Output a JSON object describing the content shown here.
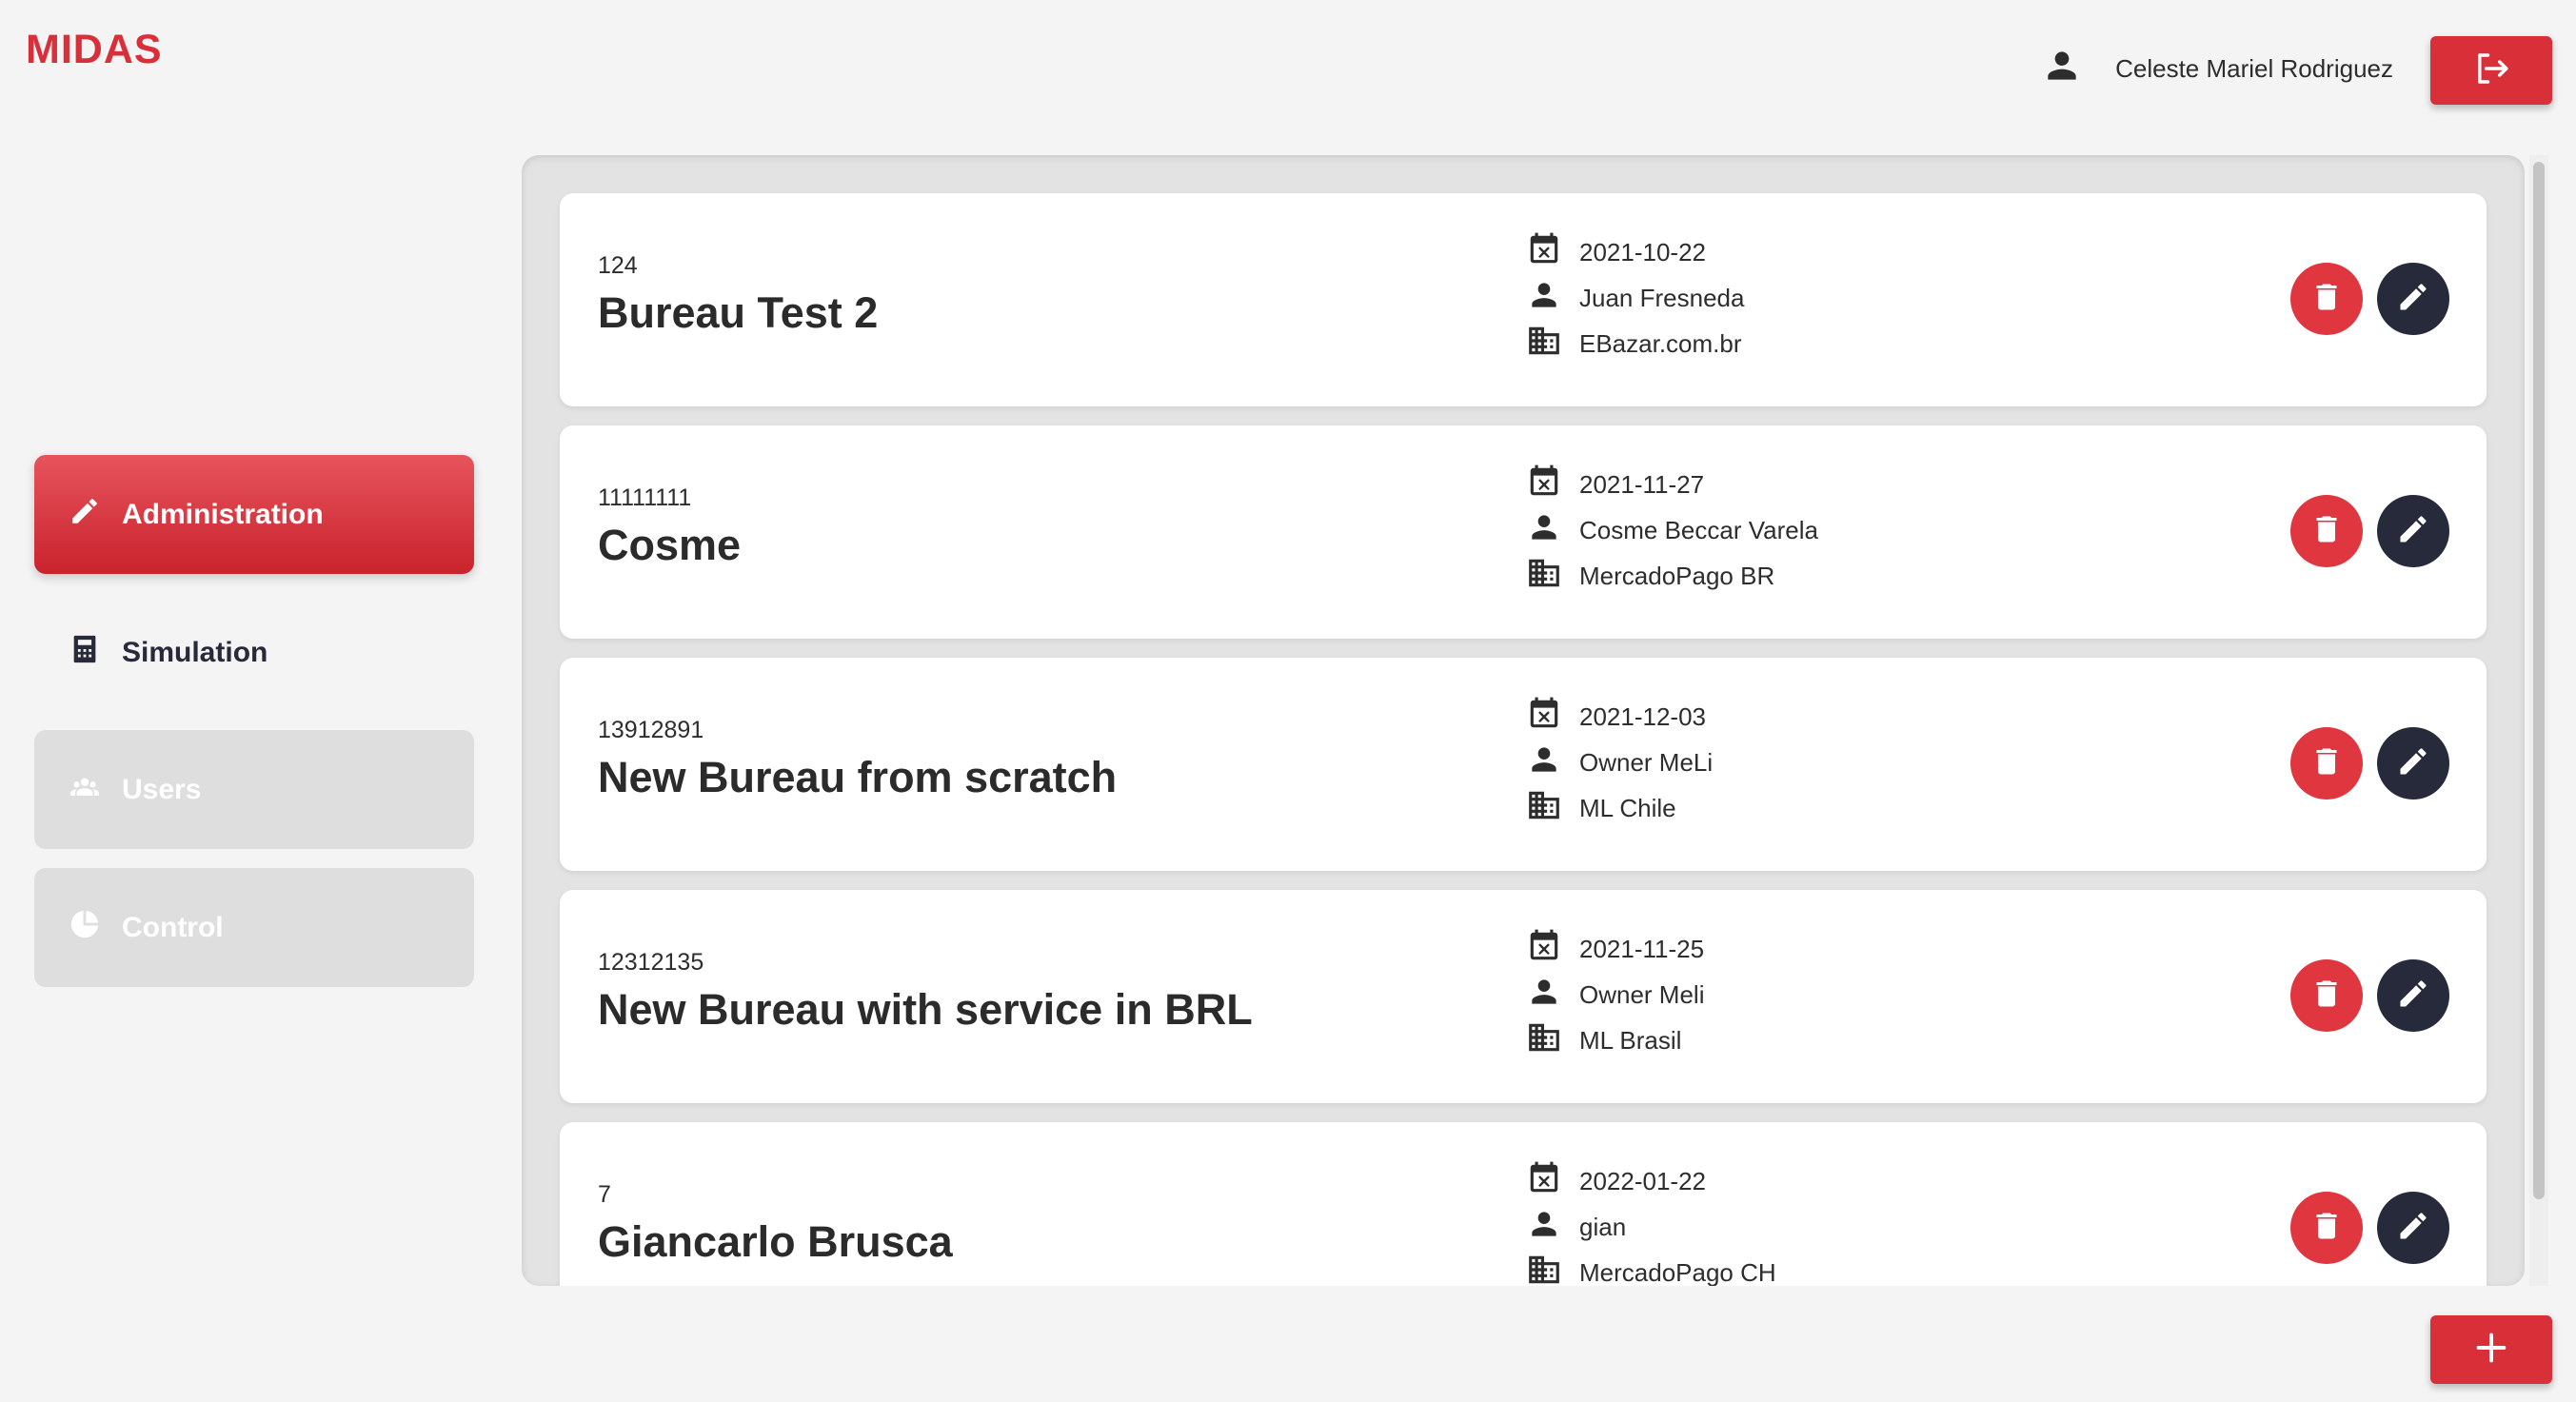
{
  "app": {
    "logo": "MIDAS"
  },
  "header": {
    "user_name": "Celeste Mariel Rodriguez",
    "user_icon": "person-icon",
    "logout_icon": "logout-icon"
  },
  "sidebar": {
    "items": [
      {
        "label": "Administration",
        "icon": "pencil-icon",
        "state": "active"
      },
      {
        "label": "Simulation",
        "icon": "calculator-icon",
        "state": "normal"
      },
      {
        "label": "Users",
        "icon": "users-icon",
        "state": "disabled"
      },
      {
        "label": "Control",
        "icon": "pie-chart-icon",
        "state": "disabled"
      }
    ]
  },
  "bureaus": [
    {
      "id": "124",
      "name": "Bureau Test 2",
      "date": "2021-10-22",
      "owner": "Juan Fresneda",
      "company": "EBazar.com.br"
    },
    {
      "id": "11111111",
      "name": "Cosme",
      "date": "2021-11-27",
      "owner": "Cosme Beccar Varela",
      "company": "MercadoPago BR"
    },
    {
      "id": "13912891",
      "name": "New Bureau from scratch",
      "date": "2021-12-03",
      "owner": "Owner MeLi",
      "company": "ML Chile"
    },
    {
      "id": "12312135",
      "name": "New Bureau with service in BRL",
      "date": "2021-11-25",
      "owner": "Owner Meli",
      "company": "ML Brasil"
    },
    {
      "id": "7",
      "name": "Giancarlo Brusca",
      "date": "2022-01-22",
      "owner": "gian",
      "company": "MercadoPago CH"
    }
  ],
  "colors": {
    "accent": "#d92f38",
    "dark": "#262a3a",
    "disabled": "#dedede"
  },
  "fab": {
    "icon": "plus-icon"
  }
}
